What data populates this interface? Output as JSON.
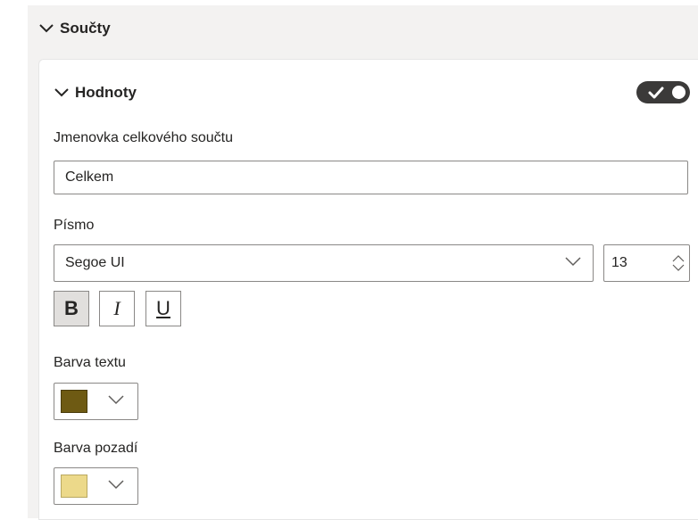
{
  "section": {
    "title": "Součty"
  },
  "card": {
    "title": "Hodnoty",
    "toggle_on": true
  },
  "label_field": {
    "label": "Jmenovka celkového součtu",
    "value": "Celkem"
  },
  "font": {
    "label": "Písmo",
    "family": "Segoe UI",
    "size": "13",
    "bold_label": "B",
    "italic_label": "I",
    "underline_label": "U",
    "bold_active": true
  },
  "text_color": {
    "label": "Barva textu",
    "color": "#6e5a13"
  },
  "background_color": {
    "label": "Barva pozadí",
    "color": "#ecd98a"
  },
  "icons": {
    "section_chevron": "chevron-down-icon",
    "card_chevron": "chevron-down-icon",
    "toggle": "check-icon",
    "dropdown": "chevron-down-icon",
    "stepper": "spin-up-down-icon"
  }
}
